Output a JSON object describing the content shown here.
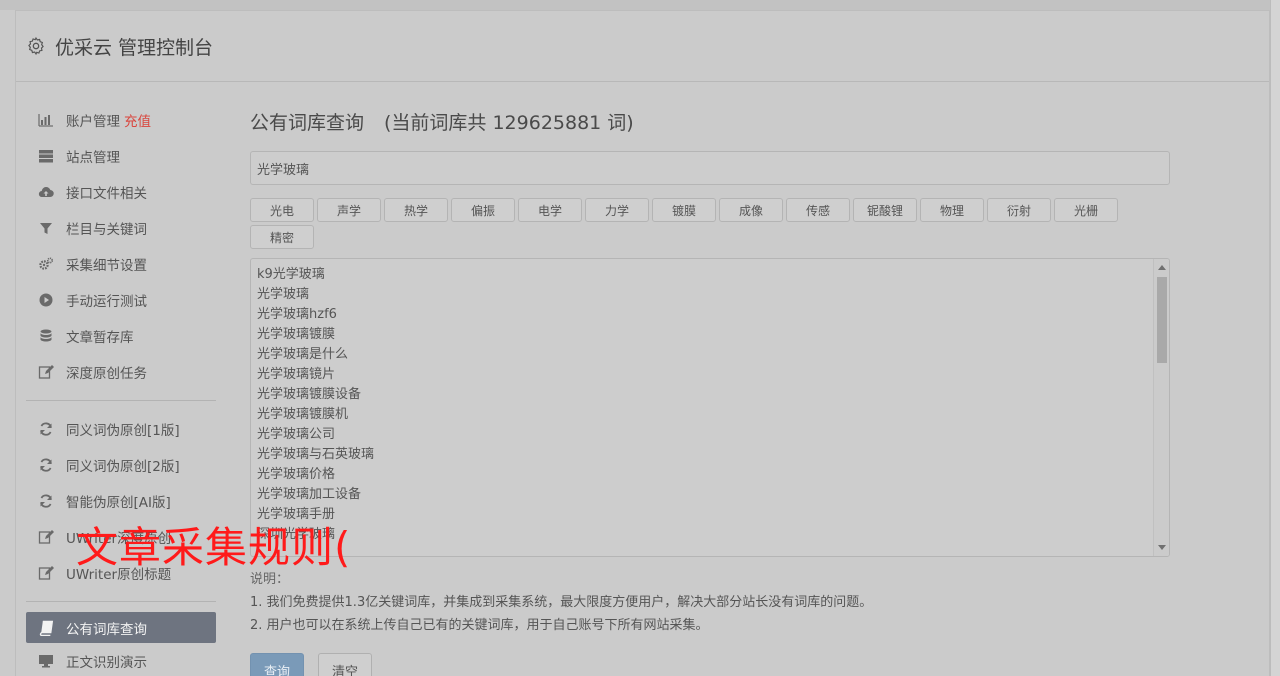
{
  "app": {
    "title": "优采云 管理控制台"
  },
  "sidebar": {
    "group1": [
      {
        "label": "账户管理",
        "highlight": "充值",
        "icon": "bar-chart-icon"
      },
      {
        "label": "站点管理",
        "icon": "server-icon"
      },
      {
        "label": "接口文件相关",
        "icon": "cloud-upload-icon"
      },
      {
        "label": "栏目与关键词",
        "icon": "filter-icon"
      },
      {
        "label": "采集细节设置",
        "icon": "gears-icon"
      },
      {
        "label": "手动运行测试",
        "icon": "play-circle-icon"
      },
      {
        "label": "文章暂存库",
        "icon": "database-icon"
      },
      {
        "label": "深度原创任务",
        "icon": "edit-icon"
      }
    ],
    "group2": [
      {
        "label": "同义词伪原创[1版]",
        "icon": "refresh-icon"
      },
      {
        "label": "同义词伪原创[2版]",
        "icon": "refresh-icon"
      },
      {
        "label": "智能伪原创[AI版]",
        "icon": "refresh-icon"
      },
      {
        "label": "UWriter深度原创",
        "icon": "edit-icon"
      },
      {
        "label": "UWriter原创标题",
        "icon": "edit-icon"
      }
    ],
    "group3": [
      {
        "label": "公有词库查询",
        "icon": "book-icon",
        "active": true
      },
      {
        "label": "正文识别演示",
        "icon": "monitor-icon"
      }
    ]
  },
  "main": {
    "heading": "公有词库查询",
    "count_text": "(当前词库共 129625881 词)",
    "search_value": "光学玻璃",
    "tags": [
      "光电",
      "声学",
      "热学",
      "偏振",
      "电学",
      "力学",
      "镀膜",
      "成像",
      "传感",
      "铌酸锂",
      "物理",
      "衍射",
      "光栅",
      "精密"
    ],
    "results": [
      "k9光学玻璃",
      "光学玻璃",
      "光学玻璃hzf6",
      "光学玻璃镀膜",
      "光学玻璃是什么",
      "光学玻璃镜片",
      "光学玻璃镀膜设备",
      "光学玻璃镀膜机",
      "光学玻璃公司",
      "光学玻璃与石英玻璃",
      "光学玻璃价格",
      "光学玻璃加工设备",
      "光学玻璃手册",
      "深圳光学玻璃"
    ],
    "notes": {
      "title": "说明：",
      "line1": "1. 我们免费提供1.3亿关键词库，并集成到采集系统，最大限度方便用户，解决大部分站长没有词库的问题。",
      "line2": "2. 用户也可以在系统上传自己已有的关键词库，用于自己账号下所有网站采集。"
    },
    "buttons": {
      "query": "查询",
      "clear": "清空"
    }
  },
  "overlay": {
    "text": "文章采集规则("
  },
  "colors": {
    "accent_red": "#d9463e",
    "active_bg": "#6e7480",
    "primary_btn": "#7a9ab8",
    "overlay_red": "#ff1a1a"
  }
}
